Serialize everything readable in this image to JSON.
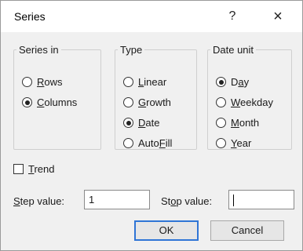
{
  "window": {
    "title": "Series",
    "help_glyph": "?",
    "close_glyph": "×"
  },
  "series_in": {
    "legend": "Series in",
    "options": [
      {
        "pre": "",
        "key": "R",
        "post": "ows",
        "selected": false
      },
      {
        "pre": "",
        "key": "C",
        "post": "olumns",
        "selected": true
      }
    ]
  },
  "type": {
    "legend": "Type",
    "options": [
      {
        "pre": "",
        "key": "L",
        "post": "inear",
        "selected": false
      },
      {
        "pre": "",
        "key": "G",
        "post": "rowth",
        "selected": false
      },
      {
        "pre": "",
        "key": "D",
        "post": "ate",
        "selected": true
      },
      {
        "pre": "Auto",
        "key": "F",
        "post": "ill",
        "selected": false
      }
    ]
  },
  "date_unit": {
    "legend": "Date unit",
    "options": [
      {
        "pre": "D",
        "key": "a",
        "post": "y",
        "selected": true
      },
      {
        "pre": "",
        "key": "W",
        "post": "eekday",
        "selected": false
      },
      {
        "pre": "",
        "key": "M",
        "post": "onth",
        "selected": false
      },
      {
        "pre": "",
        "key": "Y",
        "post": "ear",
        "selected": false
      }
    ]
  },
  "trend": {
    "pre": "",
    "key": "T",
    "post": "rend",
    "checked": false
  },
  "step": {
    "pre": "",
    "key": "S",
    "post": "tep value:",
    "value": "1"
  },
  "stop": {
    "pre": "St",
    "key": "o",
    "post": "p value:",
    "value": ""
  },
  "buttons": {
    "ok": "OK",
    "cancel": "Cancel"
  }
}
